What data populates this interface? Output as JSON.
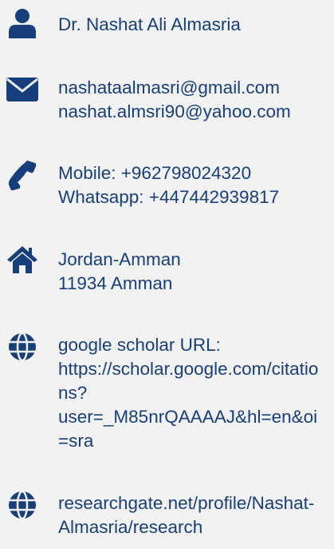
{
  "contact": {
    "name": "Dr. Nashat Ali Almasria",
    "email_1": "nashataalmasri@gmail.com",
    "email_2": "nashat.almsri90@yahoo.com",
    "mobile": "Mobile:  +962798024320",
    "whatsapp": "Whatsapp: +447442939817",
    "address_1": "Jordan-Amman",
    "address_2": "11934 Amman",
    "scholar_label": "google scholar URL:",
    "scholar_url_1": "https://scholar.google.com/citatio",
    "scholar_url_2": "ns?",
    "scholar_url_3": "user=_M85nrQAAAAJ&hl=en&oi",
    "scholar_url_4": "=sra",
    "researchgate_1": "researchgate.net/profile/Nashat-",
    "researchgate_2": "Almasria/research"
  },
  "icons": {
    "person": "user-icon",
    "email": "envelope-icon",
    "phone": "phone-icon",
    "home": "home-icon",
    "web": "globe-icon"
  },
  "colors": {
    "icon": "#163f7c",
    "text": "#163f7c",
    "background": "#f2f2f2"
  }
}
